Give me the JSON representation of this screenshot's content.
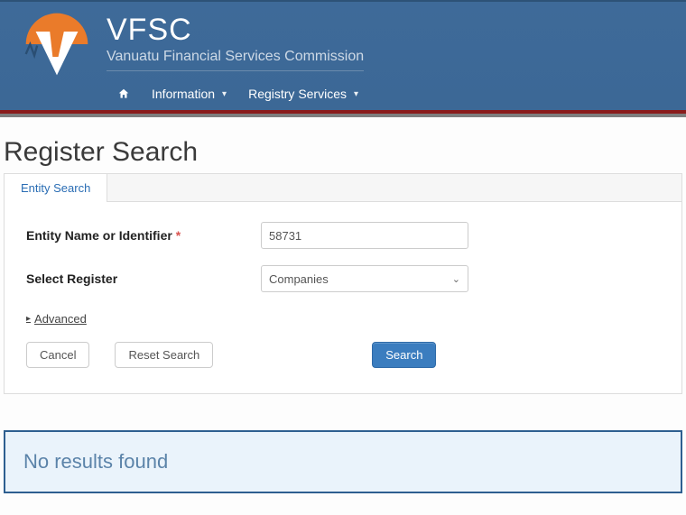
{
  "brand": {
    "title": "VFSC",
    "subtitle": "Vanuatu Financial Services Commission"
  },
  "nav": {
    "home_icon": "home-icon",
    "items": [
      {
        "label": "Information"
      },
      {
        "label": "Registry Services"
      }
    ]
  },
  "page": {
    "title": "Register Search"
  },
  "tabs": [
    {
      "label": "Entity Search"
    }
  ],
  "form": {
    "entity_label": "Entity Name or Identifier",
    "entity_value": "58731",
    "register_label": "Select Register",
    "register_value": "Companies",
    "advanced_label": "Advanced",
    "cancel_label": "Cancel",
    "reset_label": "Reset Search",
    "search_label": "Search"
  },
  "results": {
    "message": "No results found"
  }
}
